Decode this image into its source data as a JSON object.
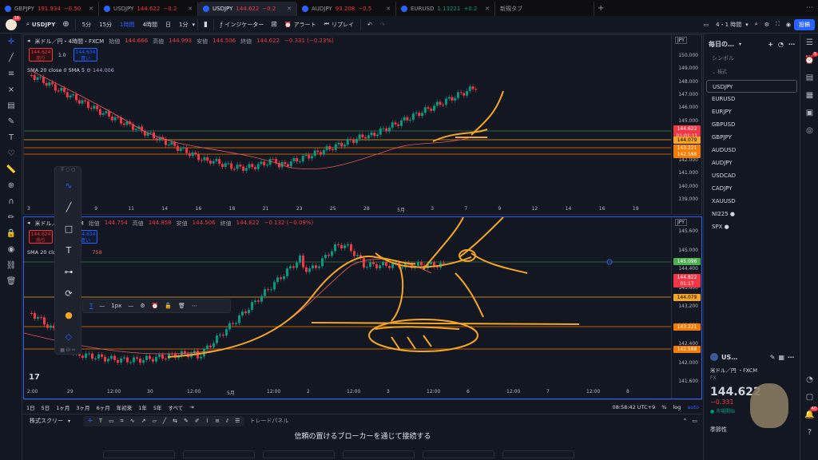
{
  "browser_tabs": [
    {
      "title": "GBPJPY",
      "price": "191.934",
      "chg": "−0.50"
    },
    {
      "title": "USDJPY",
      "price": "144.622",
      "chg": "−0.2"
    },
    {
      "title": "USDJPY",
      "price": "144.622",
      "chg": "−0.2"
    },
    {
      "title": "AUDJPY",
      "price": "93.208",
      "chg": "−0.5"
    },
    {
      "title": "EURUSD",
      "price": "1.13221",
      "chg": "+0.2"
    },
    {
      "title": "新規タブ"
    }
  ],
  "toolbar": {
    "symbol": "USDJPY",
    "intervals": [
      "5分",
      "15分",
      "1時間",
      "4時間",
      "日",
      "1分"
    ],
    "selected_interval": "1時間",
    "indicators": "インジケーター",
    "alert": "アラート",
    "replay": "リプレイ",
    "layout": "4・1 時間",
    "post": "投稿",
    "avatar_badge": "16"
  },
  "chart_top": {
    "title": "米ドル／円・4時間・FXCM",
    "open_label": "始値",
    "open": "144.666",
    "high_label": "高値",
    "high": "144.993",
    "low_label": "安値",
    "low": "144.506",
    "close_label": "終値",
    "close": "144.622",
    "change": "−0.331 (−0.23%)",
    "sell_price": "144.624",
    "sell_label": "売り",
    "spread": "1.0",
    "buy_price": "144.634",
    "buy_label": "買い",
    "sma_label": "SMA 20 close 0 SMA 5",
    "sma_value": "144.006",
    "currency": "JPY",
    "price_ticks": [
      "150.000",
      "149.000",
      "148.000",
      "147.000",
      "146.000",
      "145.000",
      "144.000",
      "143.000",
      "142.000",
      "141.000",
      "140.000",
      "139.000"
    ],
    "tags": [
      {
        "value": "144.622",
        "color": "#f23645"
      },
      {
        "value": "01:01:11",
        "color": "#f23645"
      },
      {
        "value": "144.079",
        "color": "#f5a623"
      },
      {
        "value": "143.221",
        "color": "#f57c00"
      },
      {
        "value": "142.588",
        "color": "#f57c00"
      }
    ],
    "time_ticks": [
      "3",
      "7",
      "9",
      "11",
      "14",
      "16",
      "18",
      "21",
      "23",
      "25",
      "28",
      "5月",
      "3",
      "7",
      "9",
      "12",
      "14",
      "16",
      "19"
    ]
  },
  "chart_bottom": {
    "title": "米ドル／円・FXCM",
    "open_label": "始値",
    "open": "144.754",
    "high_label": "高値",
    "high": "144.858",
    "low_label": "安値",
    "low": "144.506",
    "close_label": "終値",
    "close": "144.622",
    "change": "−0.132 (−0.09%)",
    "sell_price": "144.624",
    "sell_label": "売り",
    "buy_price": "144.634",
    "buy_label": "買い",
    "sma_label": "SMA 20 clos",
    "sma_value": "758",
    "currency": "JPY",
    "price_ticks": [
      "145.600",
      "145.000",
      "144.400",
      "143.600",
      "143.200",
      "142.800",
      "142.400",
      "142.000",
      "141.600"
    ],
    "tags": [
      {
        "value": "145.096",
        "color": "#4caf50"
      },
      {
        "value": "144.822",
        "color": "#f23645"
      },
      {
        "value": "01:17",
        "color": "#f23645"
      },
      {
        "value": "144.079",
        "color": "#f5a623"
      },
      {
        "value": "143.221",
        "color": "#f57c00"
      },
      {
        "value": "142.588",
        "color": "#f57c00"
      }
    ],
    "time_ticks": [
      "2:00",
      "29",
      "12:00",
      "30",
      "12:00",
      "5月",
      "12:00",
      "2",
      "12:00",
      "3",
      "12:00",
      "6",
      "12:00",
      "7",
      "12:00",
      "8"
    ]
  },
  "draw_props": {
    "thickness": "1px"
  },
  "bottom_bar": {
    "ranges": [
      "1日",
      "5日",
      "1ヶ月",
      "3ヶ月",
      "6ヶ月",
      "年初来",
      "1年",
      "5年",
      "すべて"
    ],
    "clock": "08:58:42 UTC+9",
    "stock_screener": "株式スクリー",
    "trade_panel": "トレードパネル",
    "connect_text": "信頼の置けるブローカーを通じて接続する"
  },
  "watchlist": {
    "header": "毎日の…",
    "symbol_label": "シンボル",
    "section": "株式",
    "items": [
      "USDJPY",
      "EURUSD",
      "EURJPY",
      "GBPUSD",
      "GBPJPY",
      "AUDUSD",
      "AUDJPY",
      "USDCAD",
      "CADJPY",
      "XAUUSD",
      "NI225 ●",
      "SPX ●"
    ],
    "selected": "USDJPY"
  },
  "detail": {
    "symbol": "US…",
    "name": "米ドル／円 ・FXCM",
    "type": "FX",
    "price": "144.622",
    "change": "−0.331",
    "status": "市場開始",
    "seasonality": "季節性"
  },
  "right_badges": [
    "5",
    "40"
  ]
}
